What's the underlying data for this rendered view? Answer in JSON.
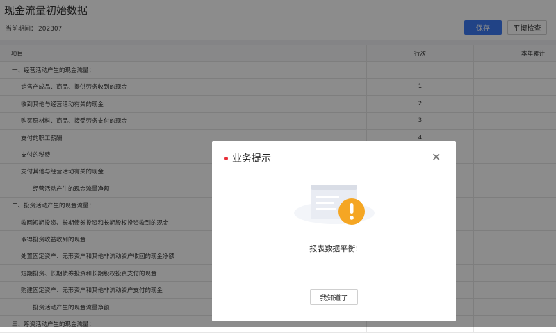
{
  "header": {
    "title": "现金流量初始数据",
    "period_label": "当前期间：",
    "period_value": "202307",
    "save_label": "保存",
    "balance_check_label": "平衡检查"
  },
  "table": {
    "columns": [
      "项目",
      "行次",
      "本年累计"
    ],
    "rows": [
      {
        "item": "一、经营活动产生的现金流量：",
        "line": "",
        "level": 0
      },
      {
        "item": "销售产成品、商品、提供劳务收到的现金",
        "line": "1",
        "level": 1
      },
      {
        "item": "收到其他与经营活动有关的现金",
        "line": "2",
        "level": 1
      },
      {
        "item": "购买原材料、商品、接受劳务支付的现金",
        "line": "3",
        "level": 1
      },
      {
        "item": "支付的职工薪酬",
        "line": "4",
        "level": 1
      },
      {
        "item": "支付的税费",
        "line": "",
        "level": 1
      },
      {
        "item": "支付其他与经营活动有关的现金",
        "line": "",
        "level": 1
      },
      {
        "item": "经营活动产生的现金流量净额",
        "line": "",
        "level": 2
      },
      {
        "item": "二、投资活动产生的现金流量：",
        "line": "",
        "level": 0
      },
      {
        "item": "收回短期投资、长期债券投资和长期股权投资收到的现金",
        "line": "",
        "level": 1
      },
      {
        "item": "取得投资收益收到的现金",
        "line": "",
        "level": 1
      },
      {
        "item": "处置固定资产、无形资产和其他非流动资产收回的现金净额",
        "line": "",
        "level": 1
      },
      {
        "item": "短期投资、长期债券投资和长期股权投资支付的现金",
        "line": "",
        "level": 1
      },
      {
        "item": "购建固定资产、无形资产和其他非流动资产支付的现金",
        "line": "",
        "level": 1
      },
      {
        "item": "投资活动产生的现金流量净额",
        "line": "",
        "level": 2
      },
      {
        "item": "三、筹资活动产生的现金流量：",
        "line": "",
        "level": 0
      }
    ]
  },
  "dialog": {
    "title": "业务提示",
    "message": "报表数据平衡!",
    "ok_label": "我知道了"
  },
  "colors": {
    "primary": "#3d7bf4",
    "warning": "#f5a623",
    "title_dot": "#e8303a"
  }
}
